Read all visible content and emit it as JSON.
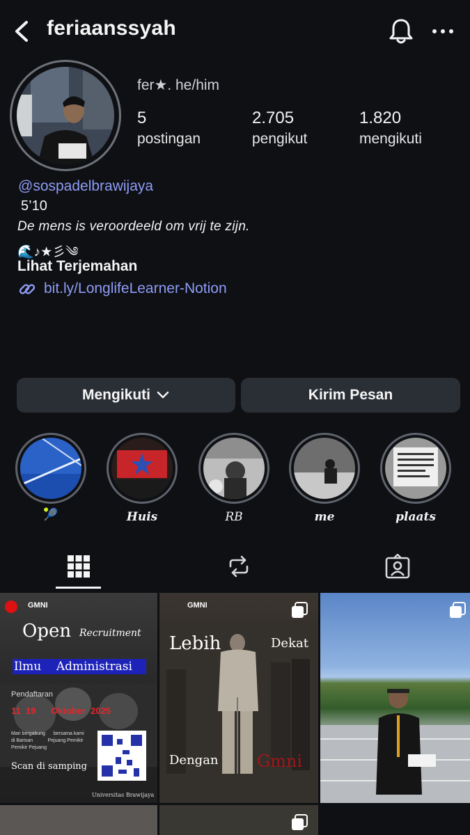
{
  "header": {
    "username": "feriaanssyah"
  },
  "profile": {
    "name_pronouns": "fer★. he/him",
    "stats": [
      {
        "value": "5",
        "label": "postingan"
      },
      {
        "value": "2.705",
        "label": "pengikut"
      },
      {
        "value": "1.820",
        "label": "mengikuti"
      }
    ],
    "mention": "@sospadelbrawijaya",
    "bio_line1": "5’10",
    "bio_line2": "De mens is veroordeeld om vrij te zijn.",
    "bio_line3": "🌊♪★彡༄",
    "translate_label": "Lihat Terjemahan",
    "link": "bit.ly/LonglifeLearner-Notion"
  },
  "actions": {
    "following_label": "Mengikuti",
    "message_label": "Kirim Pesan"
  },
  "highlights": [
    {
      "label": "🎾"
    },
    {
      "label": "Huis"
    },
    {
      "label": "RB"
    },
    {
      "label": "me"
    },
    {
      "label": "plaats"
    }
  ],
  "posts": {
    "p1": {
      "org": "GMNI",
      "title": "Open",
      "subtitle": "Recruitment",
      "banner": "Ilmu    Administrasi",
      "reg_label": "Pendaftaran",
      "dates": "11  19      Oktober  2025",
      "invite": "Mari bergabung      bersama kami\ndi Barisan           Pejuang Pemikir\nPemikir Pejuang",
      "scan": "Scan di samping",
      "footer": "Universitas Brawijaya"
    },
    "p2": {
      "org": "GMNI",
      "word1": "Lebih",
      "word2": "Dekat",
      "word3": "Dengan",
      "word4": "Gmni"
    }
  }
}
